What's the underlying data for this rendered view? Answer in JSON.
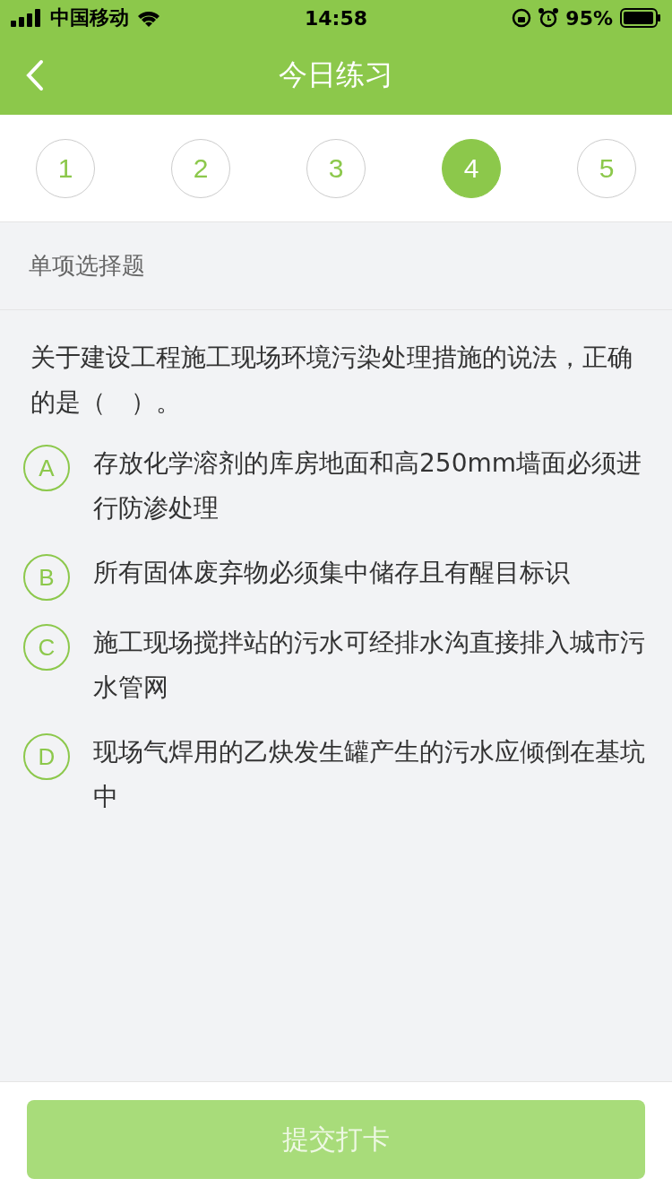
{
  "status_bar": {
    "carrier": "中国移动",
    "time": "14:58",
    "battery": "95%"
  },
  "nav": {
    "title": "今日练习"
  },
  "steps": [
    {
      "label": "1",
      "selected": false
    },
    {
      "label": "2",
      "selected": false
    },
    {
      "label": "3",
      "selected": false
    },
    {
      "label": "4",
      "selected": true
    },
    {
      "label": "5",
      "selected": false
    }
  ],
  "section": {
    "title": "单项选择题"
  },
  "question": {
    "text": "关于建设工程施工现场环境污染处理措施的说法，正确的是（　）。",
    "options": [
      {
        "letter": "A",
        "text": "存放化学溶剂的库房地面和高250mm墙面必须进行防渗处理",
        "selected": false
      },
      {
        "letter": "B",
        "text": "所有固体废弃物必须集中储存且有醒目标识",
        "selected": false
      },
      {
        "letter": "C",
        "text": "施工现场搅拌站的污水可经排水沟直接排入城市污水管网",
        "selected": false
      },
      {
        "letter": "D",
        "text": "现场气焊用的乙炔发生罐产生的污水应倾倒在基坑中",
        "selected": false
      }
    ]
  },
  "submit": {
    "label": "提交打卡",
    "disabled": true
  }
}
